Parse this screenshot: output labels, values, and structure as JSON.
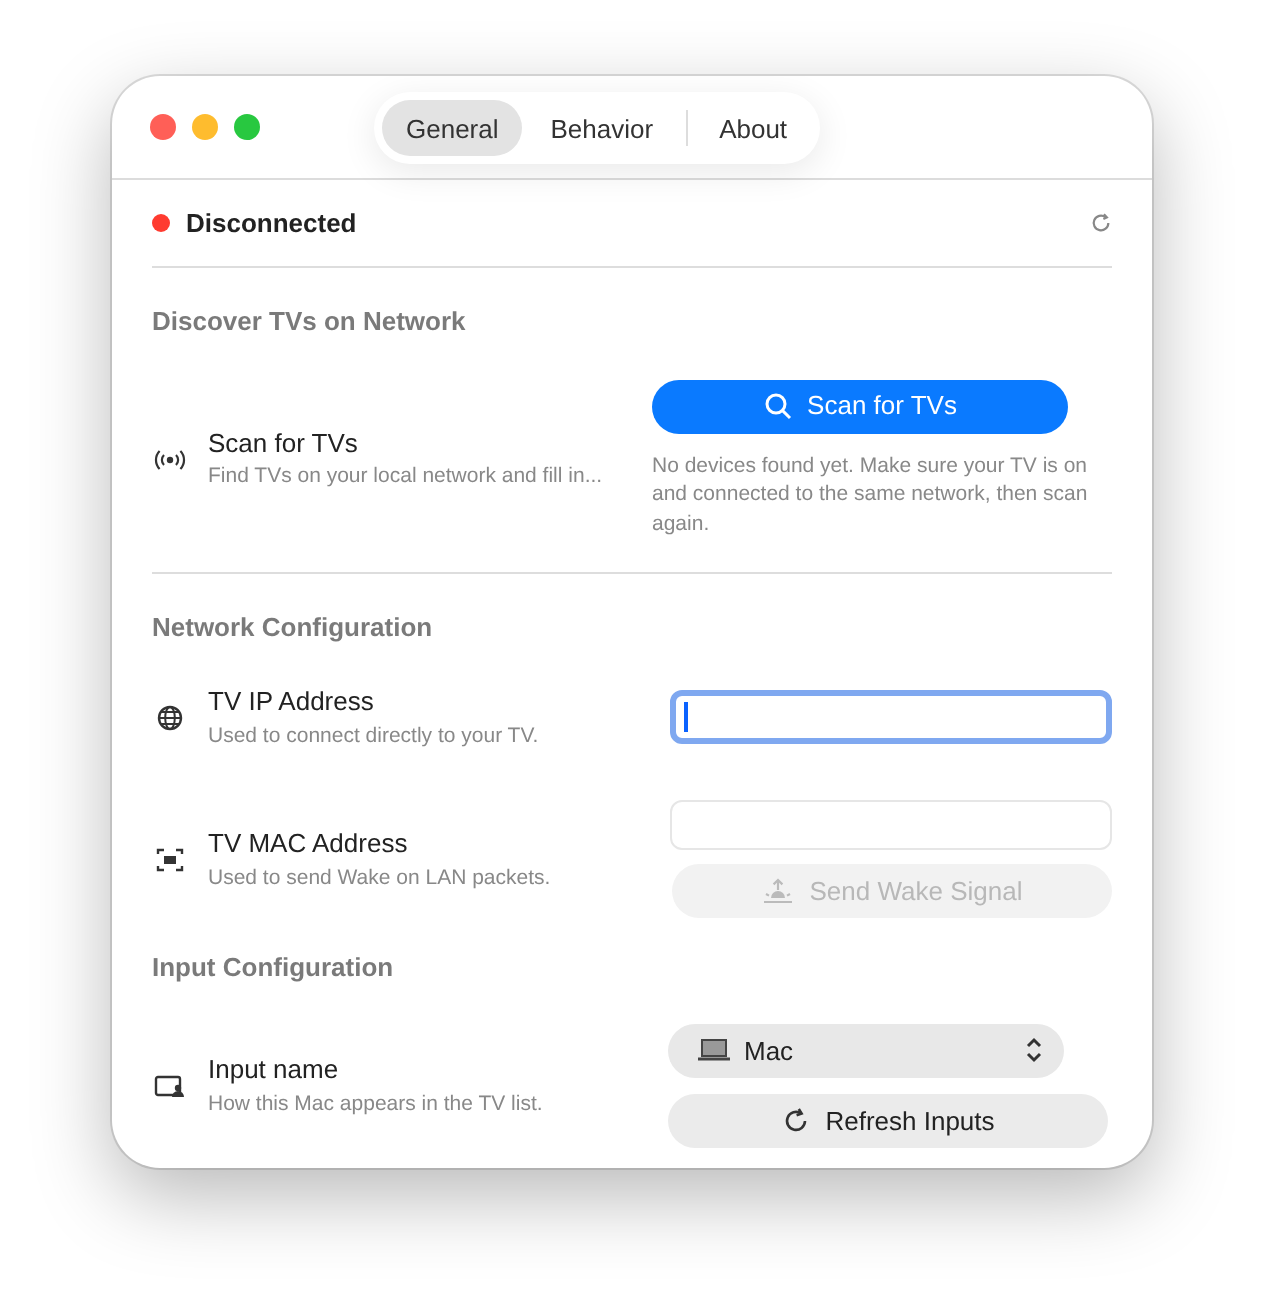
{
  "window": {
    "controls": [
      {
        "color": "#ff5f57"
      },
      {
        "color": "#febc2e"
      },
      {
        "color": "#28c840"
      }
    ]
  },
  "tabs": [
    {
      "label": "General",
      "selected": true
    },
    {
      "label": "Behavior",
      "selected": false
    },
    {
      "label": "About",
      "selected": false
    }
  ],
  "status": {
    "label": "Disconnected",
    "connected": false
  },
  "sections": [
    {
      "heading": "Discover TVs on Network",
      "rows": [
        {
          "kind": "scan",
          "title": "Scan for TVs",
          "subtitle": "Find TVs on your local network and fill in...",
          "button": {
            "label": "Scan for TVs"
          },
          "note": "No devices found yet. Make sure your TV is on and connected to the same network, then scan again."
        }
      ]
    },
    {
      "heading": "Network Configuration",
      "rows": [
        {
          "kind": "ip",
          "title": "TV IP Address",
          "subtitle": "Used to connect directly to your TV.",
          "field": {
            "focused": true
          }
        },
        {
          "kind": "mac",
          "title": "TV MAC Address",
          "subtitle": "Used to send Wake on LAN packets.",
          "field": {
            "focused": false
          },
          "button": {
            "label": "Send Wake Signal",
            "disabled": true
          }
        }
      ]
    },
    {
      "heading": "Input Configuration",
      "rows": [
        {
          "kind": "input",
          "title": "Input name",
          "subtitle": "How this Mac appears in the TV list.",
          "select": {
            "value": "Mac"
          },
          "button": {
            "label": "Refresh Inputs"
          }
        }
      ]
    }
  ]
}
